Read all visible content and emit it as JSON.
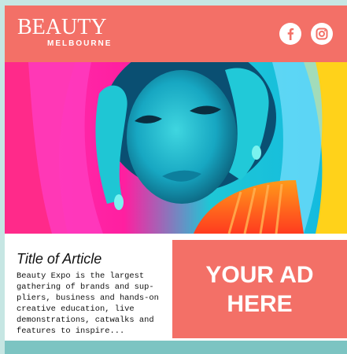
{
  "header": {
    "logo_top": "BEAUTY",
    "logo_bottom": "MELBOURNE",
    "social": [
      {
        "icon": "facebook-icon"
      },
      {
        "icon": "instagram-icon"
      }
    ]
  },
  "hero": {
    "image": "colorful-portrait-photo"
  },
  "article": {
    "title": "Title of Article",
    "body": "Beauty Expo is the largest\ngathering of brands and sup-\npliers, business and hands-on\ncreative education, live\ndemonstrations, catwalks and\nfeatures to inspire..."
  },
  "ad": {
    "text": "YOUR AD\nHERE"
  },
  "colors": {
    "brand": "#f37067",
    "teal": "#7cc4c2",
    "background": "#c6e6e3"
  }
}
